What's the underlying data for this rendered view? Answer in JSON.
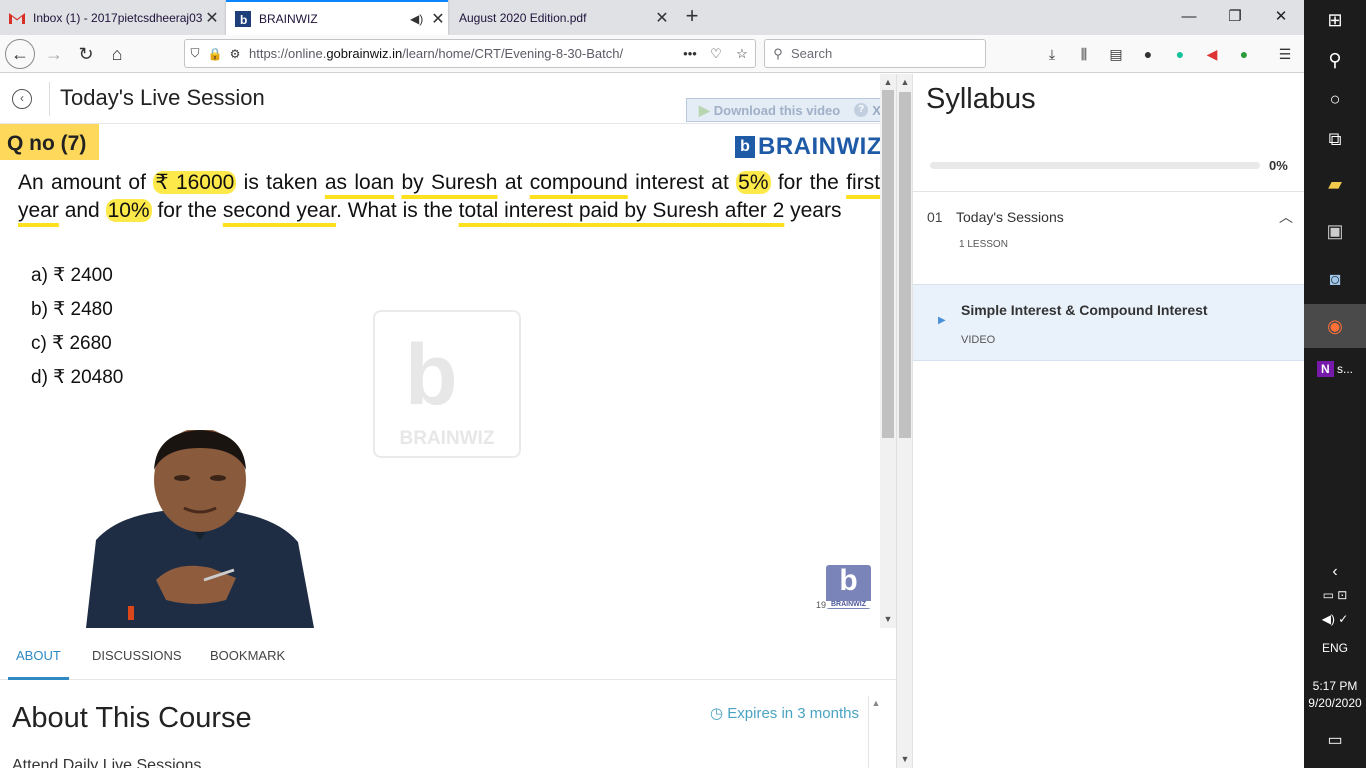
{
  "browser": {
    "tabs": [
      {
        "title": "Inbox (1) - 2017pietcsdheeraj03",
        "icon": "gmail-icon",
        "active": false
      },
      {
        "title": "BRAINWIZ",
        "icon": "brainwiz-favicon",
        "active": true,
        "audio": true
      },
      {
        "title": "August 2020 Edition.pdf",
        "icon": "pdf-icon",
        "active": false
      }
    ],
    "url_prefix": "https://online.",
    "url_domain": "gobrainwiz.in",
    "url_path": "/learn/home/CRT/Evening-8-30-Batch/",
    "search_placeholder": "Search"
  },
  "session": {
    "title": "Today's Live Session",
    "download_label": "Download this video",
    "help": "?",
    "close": "X"
  },
  "video": {
    "qno": "Q no (7)",
    "brand": "BRAINWIZ",
    "question": {
      "p1": "An amount of ",
      "h1": "₹ 16000",
      "p2": " is taken ",
      "u1": "as loan",
      "p3": " ",
      "u2": "by Suresh",
      "p4": " at ",
      "u3": "compound",
      "p5": " interest at ",
      "h2": "5%",
      "p6": " for the ",
      "u4": "first year",
      "p7": " and ",
      "h3": "10%",
      "p8": " for the ",
      "u5": "second year",
      "p9": ". What is the ",
      "u6": "total interest paid by Suresh after 2",
      "p10": " years"
    },
    "options": [
      "a) ₹ 2400",
      "b) ₹ 2480",
      "c) ₹ 2680",
      "d) ₹ 20480"
    ],
    "watermark": "BRAINWIZ",
    "corner_logo": "BRAINWIZ",
    "corner_num": "19"
  },
  "content_tabs": [
    "ABOUT",
    "DISCUSSIONS",
    "BOOKMARK"
  ],
  "about": {
    "title": "About This Course",
    "expires": "Expires in 3 months",
    "line": "Attend Daily Live Sessions"
  },
  "syllabus": {
    "title": "Syllabus",
    "progress_value": 0,
    "progress_label": "0%",
    "section_num": "01",
    "section_name": "Today's Sessions",
    "section_count": "1 LESSON",
    "lesson_name": "Simple Interest & Compound Interest",
    "lesson_type": "VIDEO"
  },
  "taskbar": {
    "lang": "ENG",
    "time": "5:17 PM",
    "date": "9/20/2020",
    "onenote_label": "s..."
  },
  "colors": {
    "accent": "#2f8ac4",
    "highlight": "#fde94a",
    "qno_bg": "#fdd85a",
    "brand": "#1f5aa6"
  }
}
